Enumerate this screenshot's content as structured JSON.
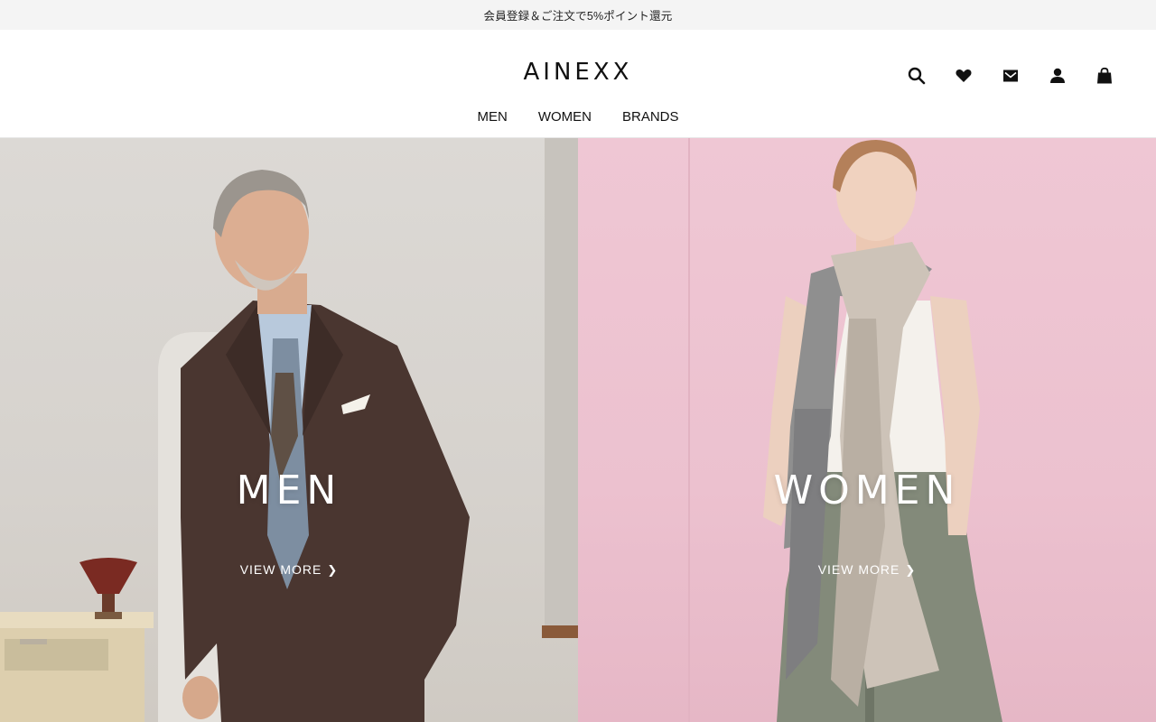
{
  "promo": {
    "text": "会員登録＆ご注文で5%ポイント還元"
  },
  "header": {
    "logo": "AINEXX",
    "icons": [
      "search-icon",
      "heart-icon",
      "mail-icon",
      "user-icon",
      "bag-icon"
    ]
  },
  "nav": {
    "items": [
      {
        "label": "MEN"
      },
      {
        "label": "WOMEN"
      },
      {
        "label": "BRANDS"
      }
    ]
  },
  "hero": {
    "men": {
      "title": "MEN",
      "cta": "VIEW MORE"
    },
    "women": {
      "title": "WOMEN",
      "cta": "VIEW MORE"
    }
  },
  "colors": {
    "promo_bg": "#f4f4f4",
    "men_bg": "#d6d2cd",
    "women_bg": "#ecc1cf",
    "text": "#111111"
  }
}
